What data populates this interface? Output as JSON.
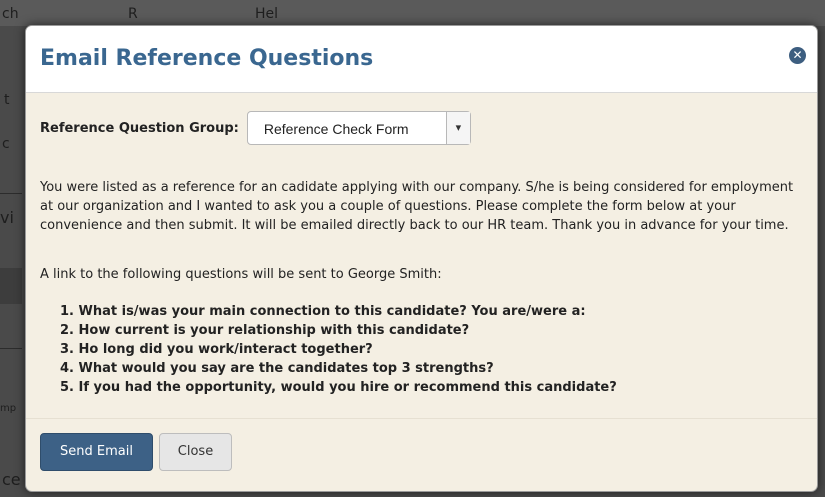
{
  "background": {
    "fragments": [
      "ch",
      "R",
      "Hel",
      "t",
      "c",
      "vi",
      "mp",
      "ce"
    ]
  },
  "modal": {
    "title": "Email Reference Questions",
    "close_icon": "close-icon",
    "group_label": "Reference Question Group:",
    "group_select_value": "Reference Check Form",
    "intro": "You were listed as a reference for an cadidate applying with our company. S/he is being considered for employment at our organization and I wanted to ask you a couple of questions.  Please complete the form below at your convenience and then submit. It will be emailed directly back to our HR team. Thank you in advance for your time.",
    "link_sentence": "A link to the following questions will be sent to George Smith:",
    "questions": [
      "1. What is/was your main connection to this candidate? You are/were a:",
      "2. How current is your relationship with this candidate?",
      "3. Ho long did you work/interact together?",
      "4. What would you say are the candidates top 3 strengths?",
      "5. If you had the opportunity, would you hire or recommend this candidate?"
    ],
    "send_label": "Send Email",
    "close_label": "Close"
  },
  "colors": {
    "title": "#3a6790",
    "primary_button": "#3d6186",
    "modal_body": "#f4efe3"
  }
}
